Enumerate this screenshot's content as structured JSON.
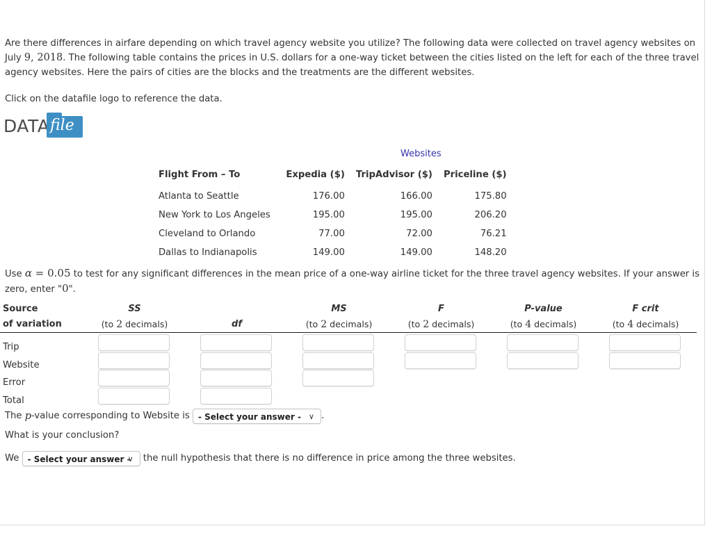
{
  "intro": {
    "paragraph_part1": "Are there differences in airfare depending on which travel agency website you utilize? The following data were collected on travel agency websites on July ",
    "date_number": "9, 2018",
    "paragraph_part2": ". The following table contains the prices in U.S. dollars for a one-way ticket between the cities listed on the left for each of the three travel agency websites. Here the pairs of cities are the blocks and the treatments are the different websites.",
    "click_line": "Click on the datafile logo to reference the data."
  },
  "datafile_logo": {
    "text_left": "DATA",
    "text_right": "file",
    "folder_color": "#3d8fc4",
    "text_color": "#4a4a4a"
  },
  "data_table": {
    "group_label": "Websites",
    "group_label_color": "#3333aa",
    "headers": [
      "Flight From – To",
      "Expedia ($)",
      "TripAdvisor ($)",
      "Priceline ($)"
    ],
    "rows": [
      [
        "Atlanta to Seattle",
        "176.00",
        "166.00",
        "175.80"
      ],
      [
        "New York to Los Angeles",
        "195.00",
        "195.00",
        "206.20"
      ],
      [
        "Cleveland to Orlando",
        "77.00",
        "72.00",
        "76.21"
      ],
      [
        "Dallas to Indianapolis",
        "149.00",
        "149.00",
        "148.20"
      ]
    ]
  },
  "instruction": {
    "prefix": "Use ",
    "alpha_symbol": "α",
    "equals": " = ",
    "alpha_value": "0.05",
    "middle": " to test for any significant differences in the mean price of a one-way airline ticket for the three travel agency websites. If your answer is zero, enter \"",
    "zero": "0",
    "suffix": "\"."
  },
  "anova": {
    "source_label_line1": "Source",
    "source_label_line2": "of variation",
    "columns": [
      {
        "name": "SS",
        "sub_prefix": "(to ",
        "sub_num": "2",
        "sub_suffix": " decimals)",
        "inputs": 4
      },
      {
        "name": "df",
        "sub_prefix": "",
        "sub_num": "",
        "sub_suffix": "",
        "inputs": 4
      },
      {
        "name": "MS",
        "sub_prefix": "(to ",
        "sub_num": "2",
        "sub_suffix": " decimals)",
        "inputs": 3
      },
      {
        "name": "F",
        "sub_prefix": "(to ",
        "sub_num": "2",
        "sub_suffix": " decimals)",
        "inputs": 2
      },
      {
        "name": "P-value",
        "sub_prefix": "(to ",
        "sub_num": "4",
        "sub_suffix": " decimals)",
        "inputs": 2
      },
      {
        "name": "F crit",
        "sub_prefix": "(to ",
        "sub_num": "4",
        "sub_suffix": " decimals)",
        "inputs": 2
      }
    ],
    "row_labels": [
      "Trip",
      "Website",
      "Error",
      "Total"
    ],
    "input_values": {
      "ss": [
        "",
        "",
        "",
        ""
      ],
      "df": [
        "",
        "",
        "",
        ""
      ],
      "ms": [
        "",
        "",
        ""
      ],
      "f": [
        "",
        ""
      ],
      "p_value": [
        "",
        ""
      ],
      "f_crit": [
        "",
        ""
      ]
    }
  },
  "pvalue_question": {
    "prefix": "The ",
    "italic_p": "p",
    "middle": "-value corresponding to Website is ",
    "select_value": "- Select your answer -",
    "suffix": "."
  },
  "conclusion": {
    "question": "What is your conclusion?",
    "prefix": "We",
    "select_value": "- Select your answer -",
    "suffix": "the null hypothesis that there is no difference in price among the three websites."
  },
  "icons": {
    "chevron_down": "∨"
  }
}
